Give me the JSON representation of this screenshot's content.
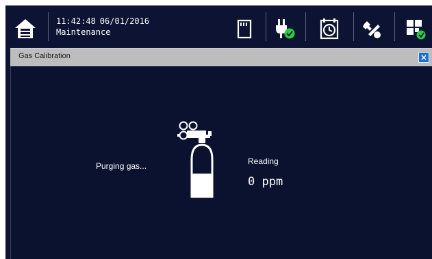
{
  "header": {
    "time": "11:42:48",
    "date": "06/01/2016",
    "mode": "Maintenance",
    "icons": [
      "home-icon",
      "sd-card-icon",
      "power-plug-ok-icon",
      "calibration-timer-icon",
      "tools-icon",
      "status-grid-icon"
    ]
  },
  "dialog": {
    "title": "Gas Calibration",
    "close_label": "×",
    "status_text": "Purging gas...",
    "reading_label": "Reading",
    "reading_value": "0 ppm"
  },
  "colors": {
    "background": "#0d1433",
    "title_bar": "#bdbdbd",
    "close_button": "#1b6fd1",
    "ok_badge": "#2ecc40"
  }
}
